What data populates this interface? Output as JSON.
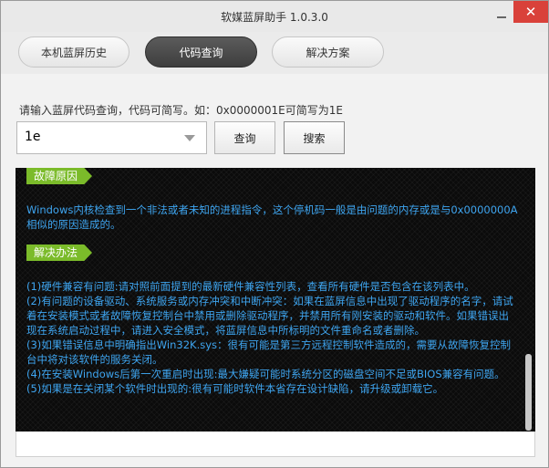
{
  "window": {
    "title": "软媒蓝屏助手 1.0.3.0"
  },
  "controls": {
    "minimize": "—",
    "close": "✕"
  },
  "tabs": [
    {
      "label": "本机蓝屏历史"
    },
    {
      "label": "代码查询"
    },
    {
      "label": "解决方案"
    }
  ],
  "query": {
    "hint": "请输入蓝屏代码查询，代码可简写。如：0x0000001E可简写为1E",
    "input_value": "1e",
    "query_button": "查询",
    "search_button": "搜索"
  },
  "result": {
    "cause_label": "故障原因",
    "cause_text": "Windows内核检查到一个非法或者未知的进程指令，这个停机码一般是由问题的内存或是与0x0000000A相似的原因造成的。",
    "solution_label": "解决办法",
    "solutions": [
      "(1)硬件兼容有问题:请对照前面提到的最新硬件兼容性列表，查看所有硬件是否包含在该列表中。",
      "(2)有问题的设备驱动、系统服务或内存冲突和中断冲突：如果在蓝屏信息中出现了驱动程序的名字，请试着在安装模式或者故障恢复控制台中禁用或删除驱动程序，并禁用所有刚安装的驱动和软件。如果错误出现在系统启动过程中，请进入安全模式，将蓝屏信息中所标明的文件重命名或者删除。",
      "(3)如果错误信息中明确指出Win32K.sys：很有可能是第三方远程控制软件造成的，需要从故障恢复控制台中将对该软件的服务关闭。",
      "(4)在安装Windows后第一次重启时出现:最大嫌疑可能时系统分区的磁盘空间不足或BIOS兼容有问题。",
      "(5)如果是在关闭某个软件时出现的:很有可能时软件本省存在设计缺陷，请升级或卸载它。"
    ]
  }
}
